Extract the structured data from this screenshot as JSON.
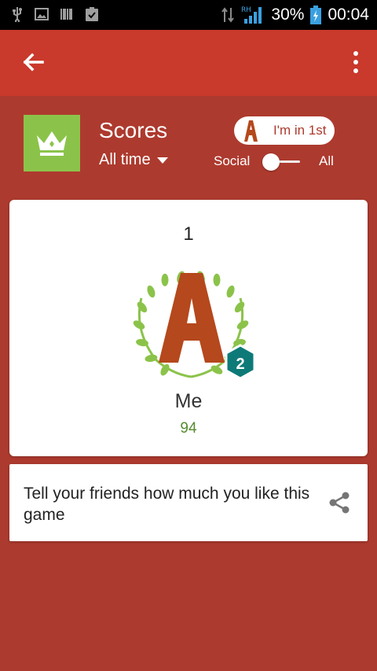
{
  "status_bar": {
    "battery": "30%",
    "time": "00:04",
    "icons": [
      "usb-icon",
      "image-icon",
      "barcode-icon",
      "clipboard-check-icon",
      "data-transfer-icon",
      "signal-icon",
      "battery-charging-icon"
    ]
  },
  "app_bar": {
    "icons": [
      "back-arrow-icon",
      "more-vert-icon"
    ]
  },
  "header": {
    "title": "Scores",
    "time_filter": "All time",
    "rank_badge": "I'm in 1st",
    "toggle_left": "Social",
    "toggle_right": "All",
    "toggle_state": "Social"
  },
  "score_card": {
    "rank": "1",
    "player_name": "Me",
    "score": "94",
    "level": "2",
    "avatar_letter": "A"
  },
  "share_card": {
    "text": "Tell your friends how much you like this game"
  },
  "colors": {
    "background": "#ad3a2e",
    "app_bar": "#c9392c",
    "game_icon": "#8bc34a",
    "score_text": "#558b2f",
    "level_badge": "#0e7a78",
    "avatar_letter": "#b5481c"
  }
}
